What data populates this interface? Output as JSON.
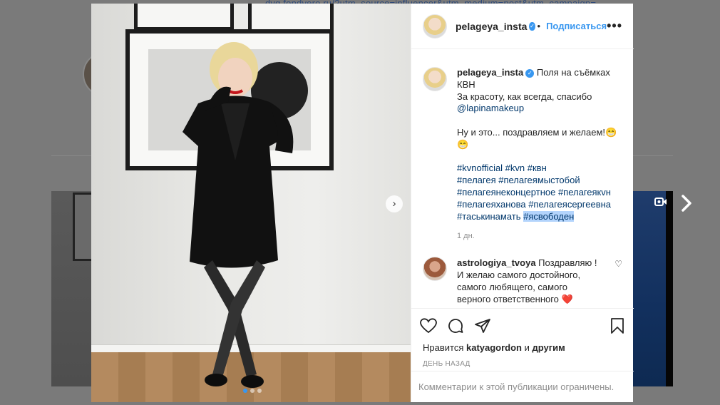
{
  "background": {
    "url_text": "dyg.fondvero.ru/?utm_source=influencer&utm_medium=post&utm_campaign=..."
  },
  "post": {
    "username": "pelageya_insta",
    "follow_label": "Подписаться",
    "separator": "•",
    "more_label": "•••",
    "caption": {
      "line1": "Поля на съёмках КВН",
      "line2": "За красоту, как всегда, спасибо",
      "mention": "@lapinamakeup",
      "line3": "Ну и это... поздравляем и желаем!😁",
      "line4": "😁",
      "tags1": "#kvnofficial #kvn #квн",
      "tags2": "#пелагея #пелагеямыстобой",
      "tags3": "#пелагеянеконцертное #пелагеякvн",
      "tags4": "#пелагеяханова #пелагеясергеевна",
      "tags5a": "#таськинамать ",
      "tags5b": "#ясвободен",
      "time": "1 дн."
    },
    "comment": {
      "username": "astrologiya_tvoya",
      "text": "Поздравляю ! И желаю самого достойного, самого любящего, самого верного ответственного ❤️"
    },
    "likes_prefix": "Нравится ",
    "likes_user": "katyagordon",
    "likes_mid": " и ",
    "likes_others": "другим",
    "date": "ДЕНЬ НАЗАД",
    "comments_closed": "Комментарии к этой публикации ограничены."
  },
  "icons": {
    "heart": "heart-icon",
    "comment": "comment-icon",
    "share": "share-icon",
    "bookmark": "bookmark-icon",
    "next": "chevron-right-icon",
    "video": "video-icon"
  }
}
